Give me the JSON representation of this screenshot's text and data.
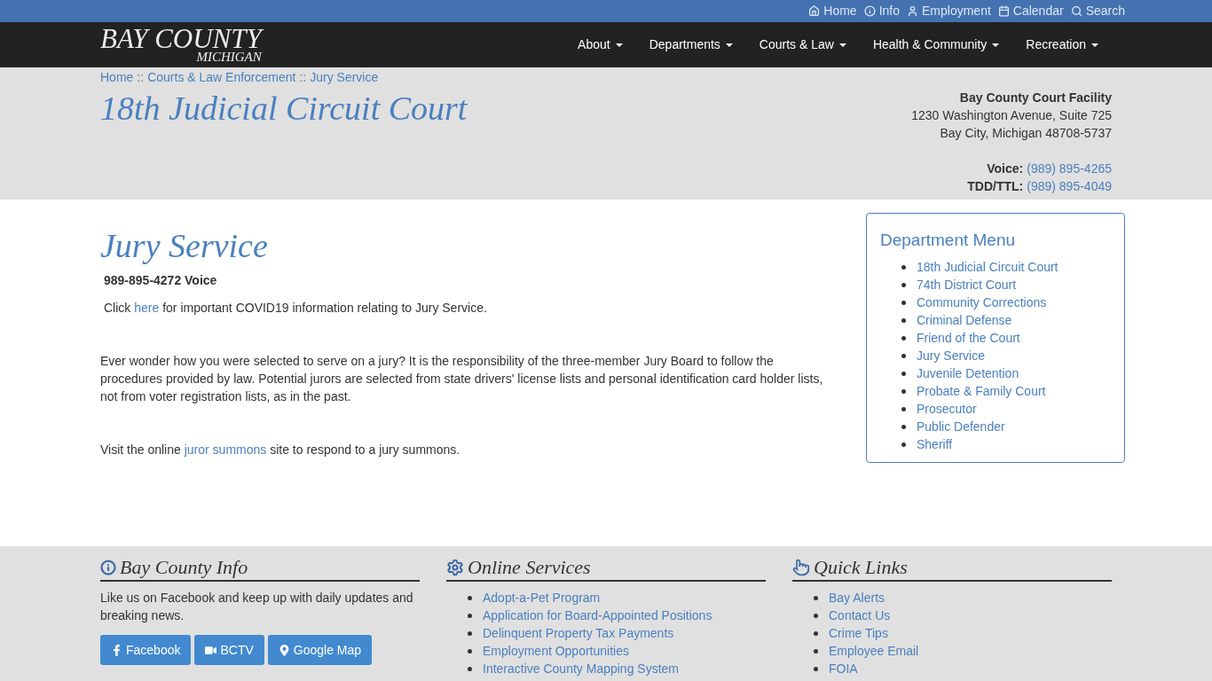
{
  "top_links": [
    {
      "kind": "home",
      "label": "Home"
    },
    {
      "kind": "info",
      "label": "Info"
    },
    {
      "kind": "user",
      "label": "Employment"
    },
    {
      "kind": "calendar",
      "label": "Calendar"
    },
    {
      "kind": "search",
      "label": "Search"
    }
  ],
  "logo": {
    "title": "BAY COUNTY",
    "subtitle": "MICHIGAN"
  },
  "nav": [
    "About",
    "Departments",
    "Courts & Law",
    "Health & Community",
    "Recreation"
  ],
  "breadcrumb": [
    "Home",
    "Courts & Law Enforcement",
    "Jury Service"
  ],
  "breadcrumb_separator": "::",
  "court_title": "18th Judicial Circuit Court",
  "facility": {
    "name": "Bay County Court Facility",
    "address": [
      "1230 Washington Avenue, Suite 725",
      "Bay City, Michigan 48708-5737"
    ],
    "phones": [
      {
        "label": "Voice:",
        "number": "(989) 895-4265"
      },
      {
        "label": "TDD/TTL:",
        "number": "(989) 895-4049"
      }
    ]
  },
  "page_title": "Jury Service",
  "phone_line": "989-895-4272 Voice",
  "paragraphs": [
    {
      "before": "Click ",
      "link": "here",
      "after": " for important COVID19 information relating to Jury Service."
    },
    {
      "before": "Ever wonder how you were selected to serve on a jury? It is the responsibility of the three-member Jury Board to follow the procedures provided by law. Potential jurors are selected from state drivers' license lists and personal identification card holder lists, not from voter registration lists, as in the past."
    },
    {
      "before": "Visit the online ",
      "link": "juror summons",
      "after": " site to respond to a jury summons."
    }
  ],
  "department_menu": {
    "title": "Department Menu",
    "items": [
      "18th Judicial Circuit Court",
      "74th District Court",
      "Community Corrections",
      "Criminal Defense",
      "Friend of the Court",
      "Jury Service",
      "Juvenile Detention",
      "Probate & Family Court",
      "Prosecutor",
      "Public Defender",
      "Sheriff"
    ]
  },
  "footer": {
    "info": {
      "title": "Bay County Info",
      "text": "Like us on Facebook and keep up with daily updates and breaking news.",
      "buttons": [
        {
          "kind": "facebook",
          "label": "Facebook"
        },
        {
          "kind": "video",
          "label": "BCTV"
        },
        {
          "kind": "map",
          "label": "Google Map"
        }
      ]
    },
    "services": {
      "title": "Online Services",
      "items": [
        "Adopt-a-Pet Program",
        "Application for Board-Appointed Positions",
        "Delinquent Property Tax Payments",
        "Employment Opportunities",
        "Interactive County Mapping System"
      ]
    },
    "quick_links": {
      "title": "Quick Links",
      "items": [
        "Bay Alerts",
        "Contact Us",
        "Crime Tips",
        "Employee Email",
        "FOIA"
      ]
    }
  }
}
